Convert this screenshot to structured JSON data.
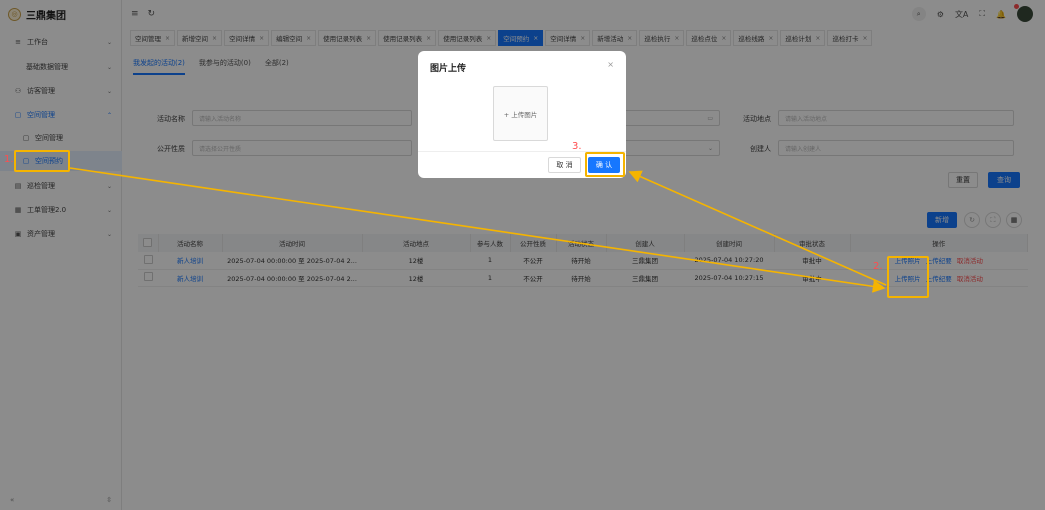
{
  "app": {
    "logo": "三鼎集团",
    "logo_mark": "◎"
  },
  "sidebar": {
    "items": [
      {
        "label": "工作台",
        "icon": "≡"
      },
      {
        "label": "基础数据管理",
        "icon": ""
      },
      {
        "label": "访客管理",
        "icon": "⚇"
      },
      {
        "label": "空间管理",
        "icon": "▢"
      },
      {
        "label": "空间管理",
        "icon": "▢"
      },
      {
        "label": "空间预约",
        "icon": "▢"
      },
      {
        "label": "巡检管理",
        "icon": "▤"
      },
      {
        "label": "工单管理2.0",
        "icon": "▦"
      },
      {
        "label": "资产管理",
        "icon": "▣"
      }
    ],
    "collapse_icon": "«",
    "collapse_right": "⇳"
  },
  "topbar": {
    "menu_icon": "≡",
    "refresh_icon": "↻",
    "icons": [
      "⌕",
      "⚙",
      "文A",
      "⛶",
      "🔔"
    ]
  },
  "tabs": [
    "空间管理",
    "新增空间",
    "空间详情",
    "编辑空间",
    "使用记录列表",
    "使用记录列表",
    "使用记录列表",
    "空间预约",
    "空间详情",
    "新增活动",
    "巡检执行",
    "巡检点位",
    "巡检线路",
    "巡检计划",
    "巡检打卡"
  ],
  "tab_close": "×",
  "subtabs": [
    "我发起的活动(2)",
    "我参与的活动(0)",
    "全部(2)"
  ],
  "filters": {
    "activity_name_label": "活动名称",
    "activity_name_placeholder": "请输入活动名称",
    "activity_place_label": "活动地点",
    "activity_place_placeholder": "请输入活动地点",
    "public_label": "公开性质",
    "public_placeholder": "请选择公开性质",
    "creator_label": "创建人",
    "creator_placeholder": "请输入创建人",
    "reset": "重置",
    "search": "查询"
  },
  "table_toolbar": {
    "new": "新增"
  },
  "table": {
    "headers": [
      "活动名称",
      "活动时间",
      "活动地点",
      "参与人数",
      "公开性质",
      "活动状态",
      "创建人",
      "创建时间",
      "审批状态",
      "操作"
    ],
    "rows": [
      {
        "name": "新人培训",
        "time": "2025-07-04 00:00:00 至 2025-07-04 2...",
        "place": "12楼",
        "count": "1",
        "public": "不公开",
        "status": "待开始",
        "creator": "三鼎集团",
        "created": "2025-07-04 10:27:20",
        "approval": "审批中"
      },
      {
        "name": "新人培训",
        "time": "2025-07-04 00:00:00 至 2025-07-04 2...",
        "place": "12楼",
        "count": "1",
        "public": "不公开",
        "status": "待开始",
        "creator": "三鼎集团",
        "created": "2025-07-04 10:27:15",
        "approval": "审批中"
      }
    ],
    "actions": {
      "upload_photo": "上传照片",
      "upload_record": "上传纪要",
      "cancel": "取消活动"
    }
  },
  "modal": {
    "title": "图片上传",
    "close": "×",
    "upload": "+ 上传图片",
    "cancel": "取 消",
    "confirm": "确 认"
  },
  "annotations": {
    "step1": "1.",
    "step2": "2.",
    "step3": "3."
  },
  "colors": {
    "primary": "#1677ff",
    "highlight": "#f5b400",
    "danger": "#ff4d4f"
  }
}
